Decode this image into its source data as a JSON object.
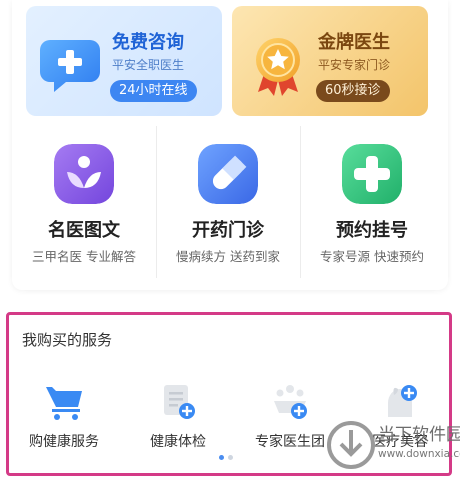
{
  "promo_cards": [
    {
      "title": "免费咨询",
      "subtitle": "平安全职医生",
      "pill": "24小时在线",
      "icon": "chat-plus-icon"
    },
    {
      "title": "金牌医生",
      "subtitle": "平安专家门诊",
      "pill": "60秒接诊",
      "icon": "gold-medal-icon"
    }
  ],
  "services": [
    {
      "name": "名医图文",
      "desc": "三甲名医 专业解答",
      "icon": "leaf-person-icon",
      "color": "#8a5ee8"
    },
    {
      "name": "开药门诊",
      "desc": "慢病续方 送药到家",
      "icon": "pill-capsule-icon",
      "color": "#4e7df0"
    },
    {
      "name": "预约挂号",
      "desc": "专家号源 快速预约",
      "icon": "medical-cross-icon",
      "color": "#33c27d"
    }
  ],
  "purchased": {
    "title": "我购买的服务",
    "items": [
      {
        "label": "购健康服务",
        "icon": "shopping-cart-icon"
      },
      {
        "label": "健康体检",
        "icon": "checkup-clipboard-icon"
      },
      {
        "label": "专家医生团",
        "icon": "doctor-team-icon"
      },
      {
        "label": "医疗美容",
        "icon": "beauty-face-icon"
      }
    ],
    "page_indicator": {
      "pages": 2,
      "current": 1
    }
  },
  "watermark": {
    "name": "当下软件园",
    "url": "www.downxia.com"
  }
}
